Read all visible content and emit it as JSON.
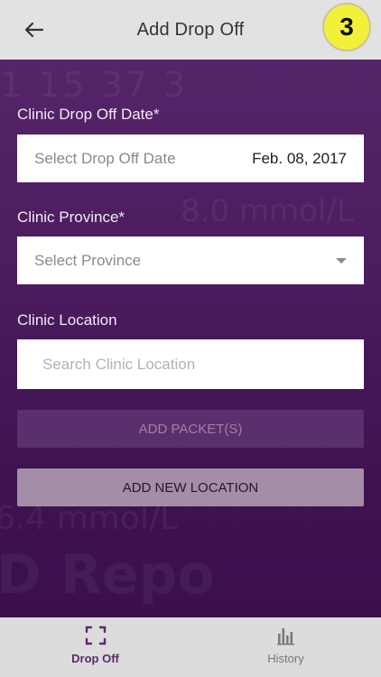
{
  "header": {
    "title": "Add Drop Off",
    "step_badge": "3",
    "back_icon": "arrow-left-icon"
  },
  "background": {
    "deco1": "1 15 37 3",
    "deco2": "8.0 mmol/L",
    "deco3": "6.4 mmol/L",
    "deco4": "D Repo"
  },
  "form": {
    "date": {
      "label": "Clinic Drop Off Date*",
      "placeholder": "Select Drop Off Date",
      "value": "Feb. 08, 2017"
    },
    "province": {
      "label": "Clinic Province*",
      "placeholder": "Select Province"
    },
    "location": {
      "label": "Clinic Location",
      "placeholder": "Search Clinic Location"
    },
    "add_packets_label": "ADD PACKET(S)",
    "add_location_label": "ADD NEW LOCATION"
  },
  "tabs": [
    {
      "label": "Drop Off",
      "icon": "scan-frame-icon",
      "active": true
    },
    {
      "label": "History",
      "icon": "bar-chart-icon",
      "active": false
    }
  ],
  "colors": {
    "accent": "#5a2a72",
    "badge": "#f3f03a",
    "background": "#4b1c5e"
  }
}
